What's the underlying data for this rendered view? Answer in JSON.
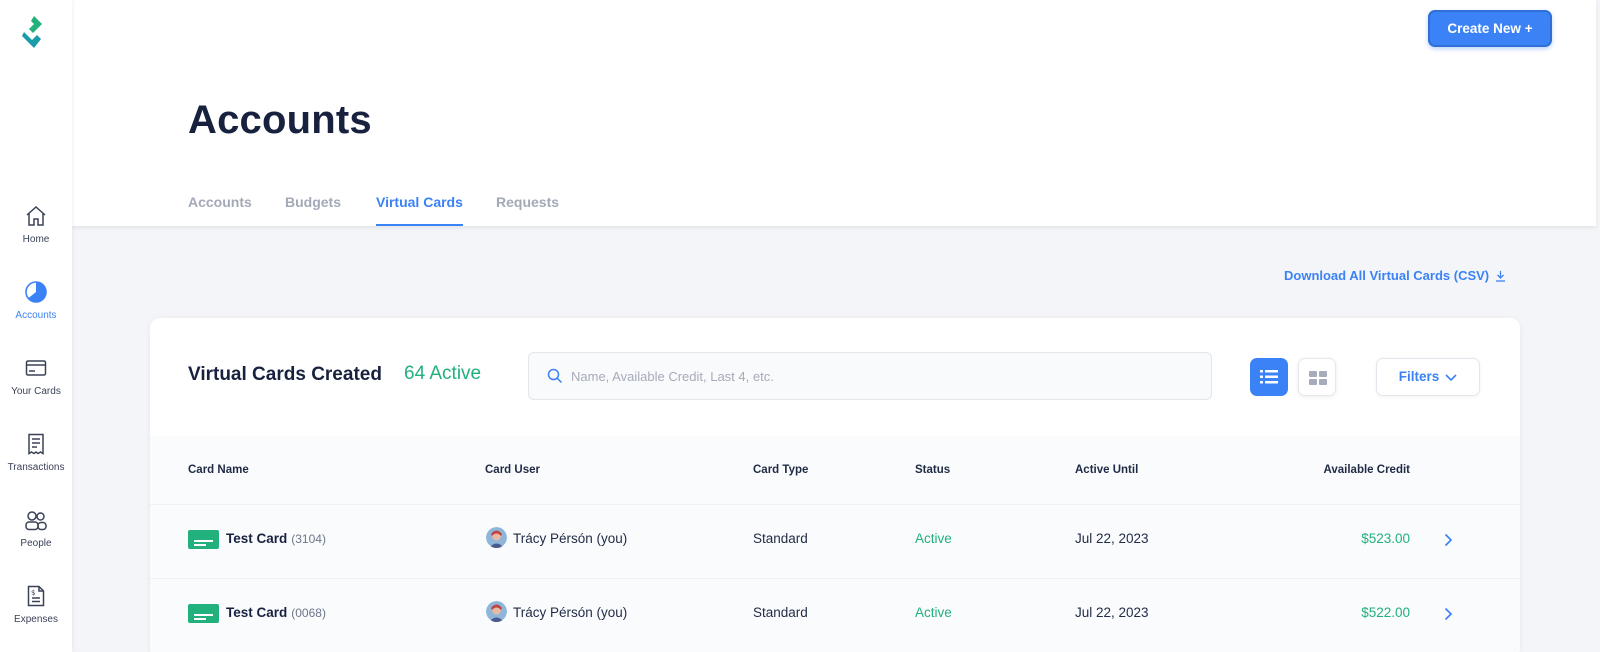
{
  "sidebar": {
    "items": [
      {
        "label": "Home",
        "icon": "home-icon"
      },
      {
        "label": "Accounts",
        "icon": "pie-chart-icon"
      },
      {
        "label": "Your Cards",
        "icon": "credit-card-icon"
      },
      {
        "label": "Transactions",
        "icon": "receipt-icon"
      },
      {
        "label": "People",
        "icon": "people-icon"
      },
      {
        "label": "Expenses",
        "icon": "expense-doc-icon"
      }
    ]
  },
  "header": {
    "create_button": "Create New +",
    "title": "Accounts",
    "tabs": [
      {
        "label": "Accounts"
      },
      {
        "label": "Budgets"
      },
      {
        "label": "Virtual Cards"
      },
      {
        "label": "Requests"
      }
    ]
  },
  "download_link": "Download All Virtual Cards (CSV)",
  "panel": {
    "title": "Virtual Cards Created",
    "active_count": "64 Active",
    "search_placeholder": "Name, Available Credit, Last 4, etc.",
    "filters_label": "Filters"
  },
  "table": {
    "columns": [
      "Card Name",
      "Card User",
      "Card Type",
      "Status",
      "Active Until",
      "Available Credit"
    ],
    "rows": [
      {
        "name": "Test Card",
        "last4": "(3104)",
        "user": "Trácy Pérsón (you)",
        "type": "Standard",
        "status": "Active",
        "active_until": "Jul 22, 2023",
        "credit": "$523.00"
      },
      {
        "name": "Test Card",
        "last4": "(0068)",
        "user": "Trácy Pérsón (you)",
        "type": "Standard",
        "status": "Active",
        "active_until": "Jul 22, 2023",
        "credit": "$522.00"
      }
    ]
  },
  "colors": {
    "accent": "#3b82f6",
    "success": "#22b07d",
    "title": "#18223f"
  }
}
